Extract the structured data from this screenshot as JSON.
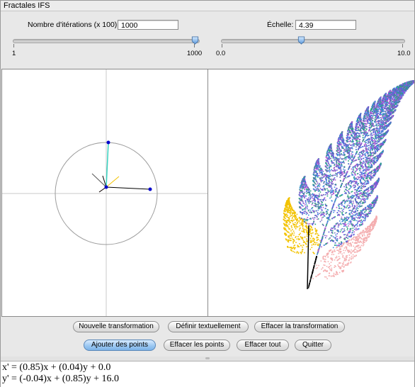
{
  "window": {
    "title": "Fractales IFS"
  },
  "controls": {
    "iterations": {
      "label": "Nombre d'itérations (x 100):",
      "value": "1000",
      "slider_min": "1",
      "slider_max": "1000",
      "level_fraction": 1.0
    },
    "scale": {
      "label": "Échelle:",
      "value": "4.39",
      "slider_min": "0.0",
      "slider_max": "10.0",
      "level_fraction": 0.439
    }
  },
  "buttons": {
    "row1": [
      "Nouvelle transformation",
      "Définir textuellement",
      "Effacer la transformation"
    ],
    "row2": [
      "Ajouter des points",
      "Effacer les points",
      "Effacer tout",
      "Quitter"
    ]
  },
  "formula": {
    "line1": "x' = (0.85)x + (0.04)y + 0.0",
    "line2": "y' = (-0.04)x + (0.85)y + 16.0"
  },
  "colors": {
    "fern_stem": "#000000",
    "fern_pink": "#f4aeb0",
    "fern_yellow": "#f2c200",
    "fern_main": [
      "#5a5ad8",
      "#2aa37d",
      "#b455d2",
      "#3f8de0",
      "#6b6bbd"
    ],
    "point": "#0000cc",
    "default_button": "#8fbde9"
  },
  "icons": [
    "slider-thumb-icon",
    "point-marker-icon"
  ]
}
